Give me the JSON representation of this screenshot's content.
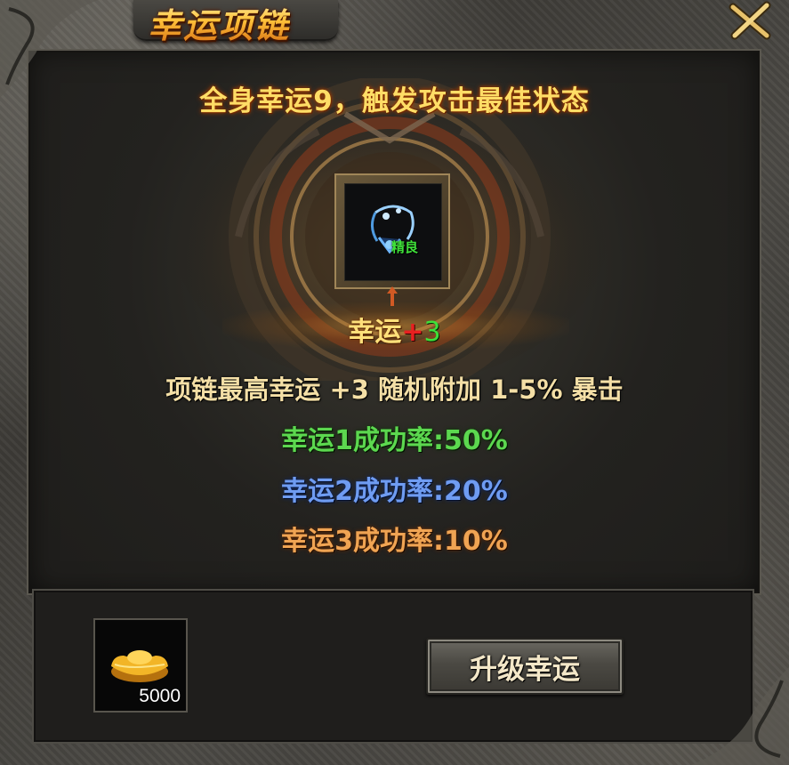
{
  "window": {
    "title": "幸运项链",
    "close_icon": "close-x-icon"
  },
  "panel": {
    "headline": "全身幸运9，触发攻击最佳状态",
    "equipment_slot": {
      "icon": "necklace-icon",
      "quality_label": "精良"
    },
    "luck": {
      "label": "幸运",
      "plus_sign": "+",
      "value": "3"
    },
    "description": "项链最高幸运 +3 随机附加 1-5% 暴击",
    "rates": [
      {
        "text": "幸运1成功率:50%",
        "color": "#5cd84f"
      },
      {
        "text": "幸运2成功率:20%",
        "color": "#6f9cf2"
      },
      {
        "text": "幸运3成功率:10%",
        "color": "#f0a453"
      }
    ]
  },
  "cost": {
    "icon": "gold-ingot-icon",
    "amount": "5000"
  },
  "actions": {
    "upgrade_label": "升级幸运"
  },
  "colors": {
    "title_gold": "#ffc23a",
    "luck_plus_red": "#e82020",
    "luck_value_green": "#3fe03a"
  }
}
